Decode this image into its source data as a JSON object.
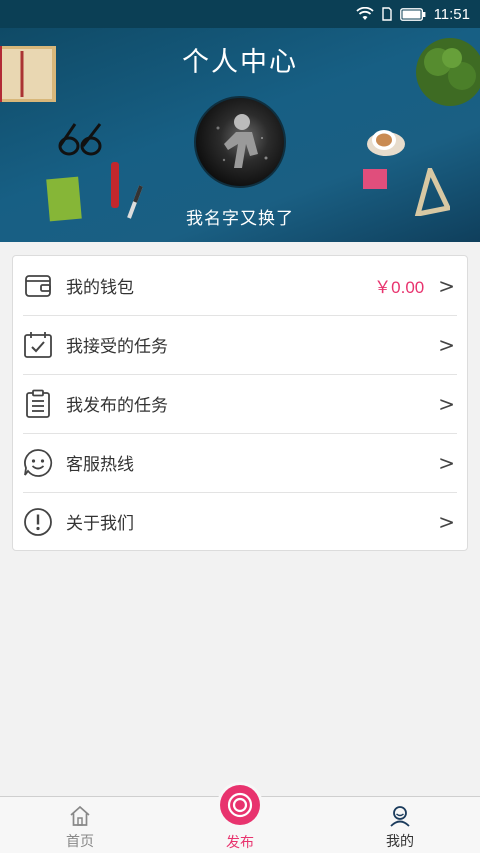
{
  "status_bar": {
    "time": "11:51",
    "icons": [
      "wifi-icon",
      "sim-icon",
      "battery-icon"
    ]
  },
  "header": {
    "title": "个人中心",
    "username": "我名字又换了"
  },
  "menu": [
    {
      "label": "我的钱包",
      "value": "￥0.00",
      "arrow": ">",
      "icon": "wallet-icon"
    },
    {
      "label": "我接受的任务",
      "value": "",
      "arrow": ">",
      "icon": "calendar-check-icon"
    },
    {
      "label": "我发布的任务",
      "value": "",
      "arrow": ">",
      "icon": "clipboard-icon"
    },
    {
      "label": "客服热线",
      "value": "",
      "arrow": ">",
      "icon": "smiley-icon"
    },
    {
      "label": "关于我们",
      "value": "",
      "arrow": ">",
      "icon": "info-icon"
    }
  ],
  "nav": [
    {
      "label": "首页",
      "icon": "home-icon"
    },
    {
      "label": "发布",
      "icon": "publish-icon"
    },
    {
      "label": "我的",
      "icon": "user-icon"
    }
  ],
  "colors": {
    "accent": "#e8336e",
    "header_bg": "#175f84"
  }
}
